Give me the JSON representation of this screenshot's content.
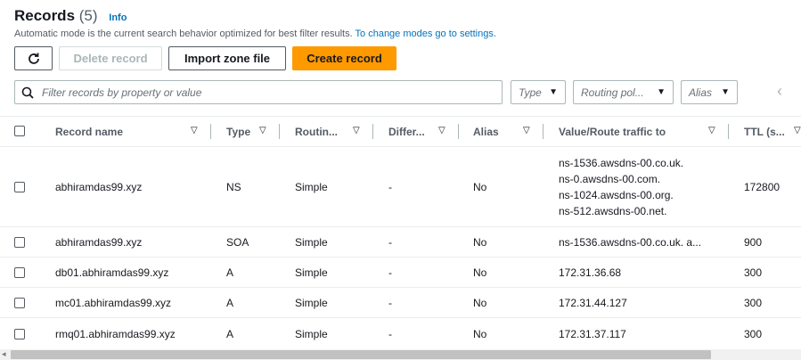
{
  "header": {
    "title": "Records",
    "count": "(5)",
    "info": "Info",
    "desc_text": "Automatic mode is the current search behavior optimized for best filter results.",
    "desc_link": "To change modes go to settings."
  },
  "toolbar": {
    "refresh_icon": "refresh-icon",
    "delete_label": "Delete record",
    "import_label": "Import zone file",
    "create_label": "Create record"
  },
  "filter": {
    "search_placeholder": "Filter records by property or value",
    "type_placeholder": "Type",
    "routing_placeholder": "Routing pol...",
    "alias_placeholder": "Alias"
  },
  "columns": {
    "name": "Record name",
    "type": "Type",
    "routing": "Routin...",
    "differ": "Differ...",
    "alias": "Alias",
    "value": "Value/Route traffic to",
    "ttl": "TTL (s..."
  },
  "rows": [
    {
      "name": "abhiramdas99.xyz",
      "type": "NS",
      "routing": "Simple",
      "differ": "-",
      "alias": "No",
      "value": [
        "ns-1536.awsdns-00.co.uk.",
        "ns-0.awsdns-00.com.",
        "ns-1024.awsdns-00.org.",
        "ns-512.awsdns-00.net."
      ],
      "ttl": "172800"
    },
    {
      "name": "abhiramdas99.xyz",
      "type": "SOA",
      "routing": "Simple",
      "differ": "-",
      "alias": "No",
      "value": [
        "ns-1536.awsdns-00.co.uk. a..."
      ],
      "ttl": "900"
    },
    {
      "name": "db01.abhiramdas99.xyz",
      "type": "A",
      "routing": "Simple",
      "differ": "-",
      "alias": "No",
      "value": [
        "172.31.36.68"
      ],
      "ttl": "300"
    },
    {
      "name": "mc01.abhiramdas99.xyz",
      "type": "A",
      "routing": "Simple",
      "differ": "-",
      "alias": "No",
      "value": [
        "172.31.44.127"
      ],
      "ttl": "300"
    },
    {
      "name": "rmq01.abhiramdas99.xyz",
      "type": "A",
      "routing": "Simple",
      "differ": "-",
      "alias": "No",
      "value": [
        "172.31.37.117"
      ],
      "ttl": "300"
    }
  ]
}
